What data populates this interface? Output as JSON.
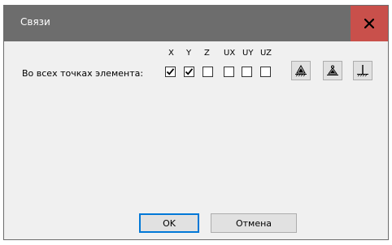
{
  "window": {
    "title": "Связи",
    "close_icon": "close-icon"
  },
  "constraints": {
    "row_label": "Во всех точках элемента:",
    "axes": [
      {
        "label": "X",
        "checked": true
      },
      {
        "label": "Y",
        "checked": true
      },
      {
        "label": "Z",
        "checked": false
      },
      {
        "label": "UX",
        "checked": false
      },
      {
        "label": "UY",
        "checked": false
      },
      {
        "label": "UZ",
        "checked": false
      }
    ],
    "preset_buttons": [
      {
        "icon": "fixed-support-icon"
      },
      {
        "icon": "pinned-support-icon"
      },
      {
        "icon": "clamp-support-icon"
      }
    ]
  },
  "footer": {
    "ok_label": "OK",
    "cancel_label": "Отмена"
  },
  "colors": {
    "titlebar": "#6d6d6d",
    "close_bg": "#c9504b",
    "dialog_bg": "#f0f0f0",
    "accent": "#0078d7"
  }
}
